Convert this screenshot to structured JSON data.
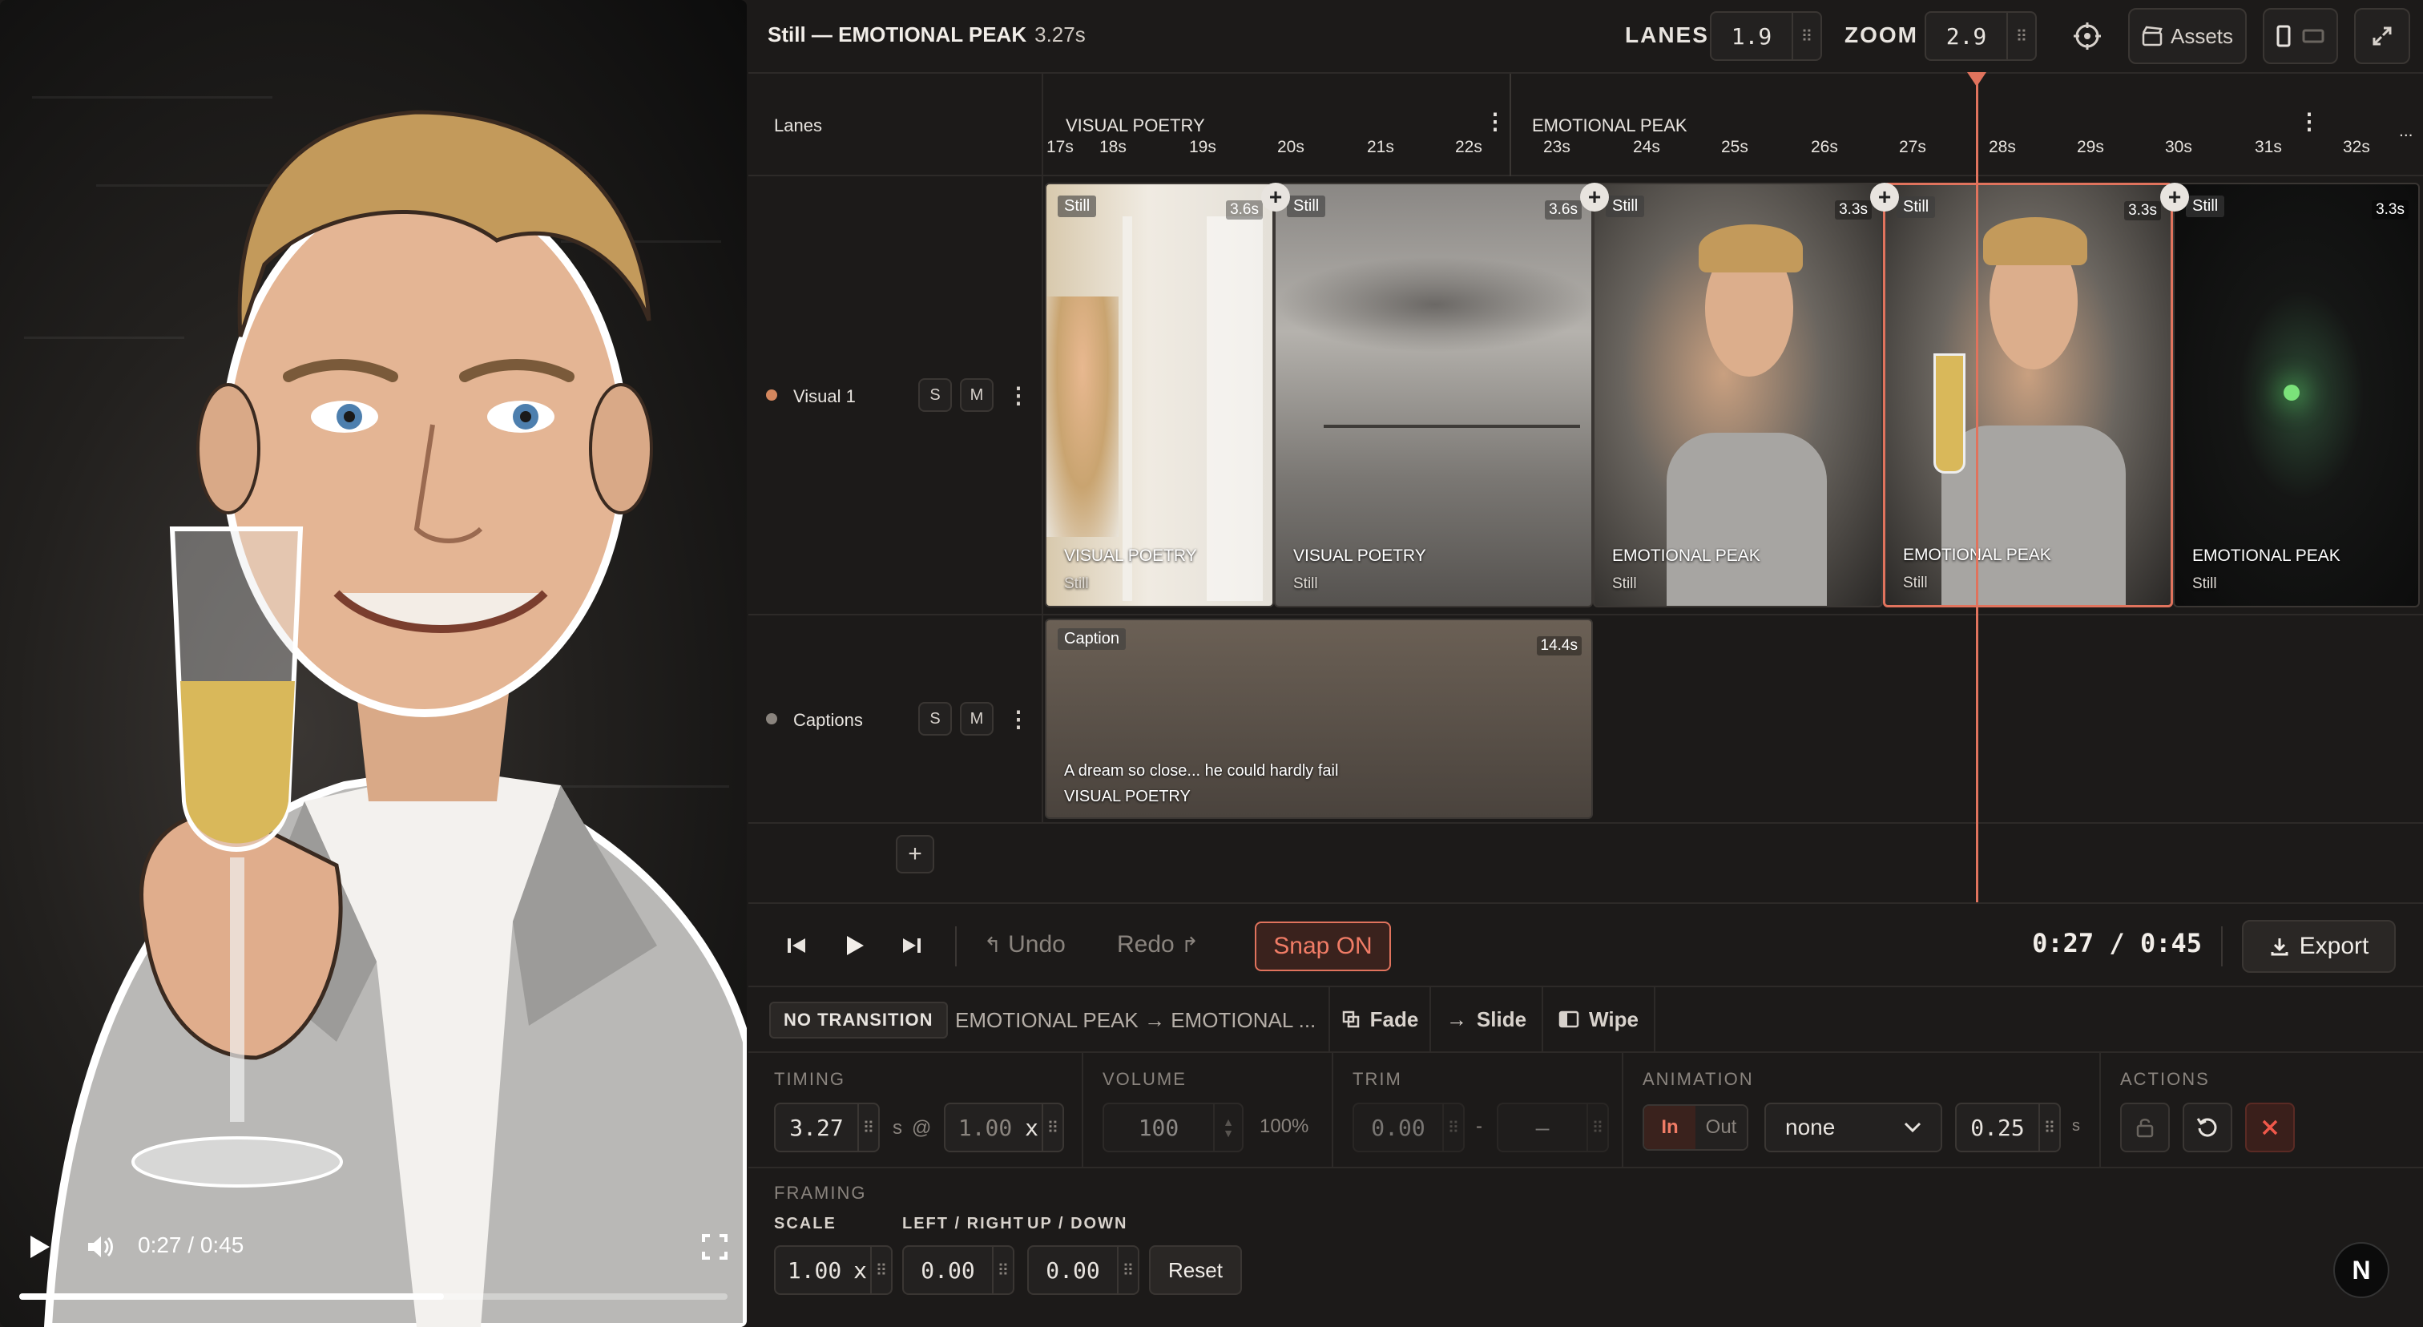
{
  "preview": {
    "time": "0:27 / 0:45",
    "progress": 0.6,
    "icons": [
      "play-icon",
      "volume-icon",
      "fullscreen-icon"
    ]
  },
  "header": {
    "title": "Still — EMOTIONAL PEAK",
    "duration": "3.27s",
    "lanes_label": "LANES",
    "lanes_value": "1.9",
    "zoom_label": "ZOOM",
    "zoom_value": "2.9",
    "assets_label": "Assets"
  },
  "timeline": {
    "lanes_header": "Lanes",
    "sections": [
      "VISUAL POETRY",
      "EMOTIONAL PEAK"
    ],
    "ticks_a": [
      "17s",
      "18s",
      "19s",
      "20s",
      "21s",
      "22s"
    ],
    "ticks_b": [
      "23s",
      "24s",
      "25s",
      "26s",
      "27s",
      "28s",
      "29s",
      "30s",
      "31s",
      "32s"
    ],
    "more": "...",
    "lanes": [
      {
        "name": "Visual 1",
        "solo": "S",
        "mute": "M"
      },
      {
        "name": "Captions",
        "solo": "S",
        "mute": "M"
      }
    ],
    "clips": [
      {
        "badge": "Still",
        "dur": "3.6s",
        "name": "VISUAL POETRY",
        "kind": "Still"
      },
      {
        "badge": "Still",
        "dur": "3.6s",
        "name": "VISUAL POETRY",
        "kind": "Still"
      },
      {
        "badge": "Still",
        "dur": "3.3s",
        "name": "EMOTIONAL PEAK",
        "kind": "Still"
      },
      {
        "badge": "Still",
        "dur": "3.3s",
        "name": "EMOTIONAL PEAK",
        "kind": "Still"
      },
      {
        "badge": "Still",
        "dur": "3.3s",
        "name": "EMOTIONAL PEAK",
        "kind": "Still"
      }
    ],
    "caption_clip": {
      "badge": "Caption",
      "dur": "14.4s",
      "text": "A dream so close... he could hardly fail",
      "section": "VISUAL POETRY"
    }
  },
  "transport": {
    "undo": "Undo",
    "redo": "Redo",
    "snap": "Snap ON",
    "timecode": "0:27 / 0:45",
    "export": "Export"
  },
  "transitions": {
    "current": "NO TRANSITION",
    "desc": "EMOTIONAL PEAK → EMOTIONAL ...",
    "options": [
      "Fade",
      "Slide",
      "Wipe"
    ]
  },
  "props": {
    "timing_label": "TIMING",
    "timing_value": "3.27",
    "timing_unit": "s",
    "at": "@",
    "speed_value": "1.00",
    "speed_unit": "x",
    "volume_label": "VOLUME",
    "volume_value": "100",
    "volume_pct": "100%",
    "trim_label": "TRIM",
    "trim_in": "0.00",
    "trim_sep": "-",
    "trim_out": "—",
    "animation_label": "ANIMATION",
    "anim_in": "In",
    "anim_out": "Out",
    "anim_select": "none",
    "anim_dur": "0.25",
    "anim_unit": "s",
    "actions_label": "ACTIONS",
    "framing_label": "FRAMING",
    "scale_label": "SCALE",
    "leftright_label": "LEFT / RIGHT",
    "updown_label": "UP / DOWN",
    "scale_value": "1.00",
    "scale_unit": "x",
    "lr_value": "0.00",
    "ud_value": "0.00",
    "reset": "Reset"
  },
  "badge": "N",
  "colors": {
    "accent": "#e0735d",
    "visual_dot": "#d4875e",
    "caption_dot": "#8a847e"
  }
}
